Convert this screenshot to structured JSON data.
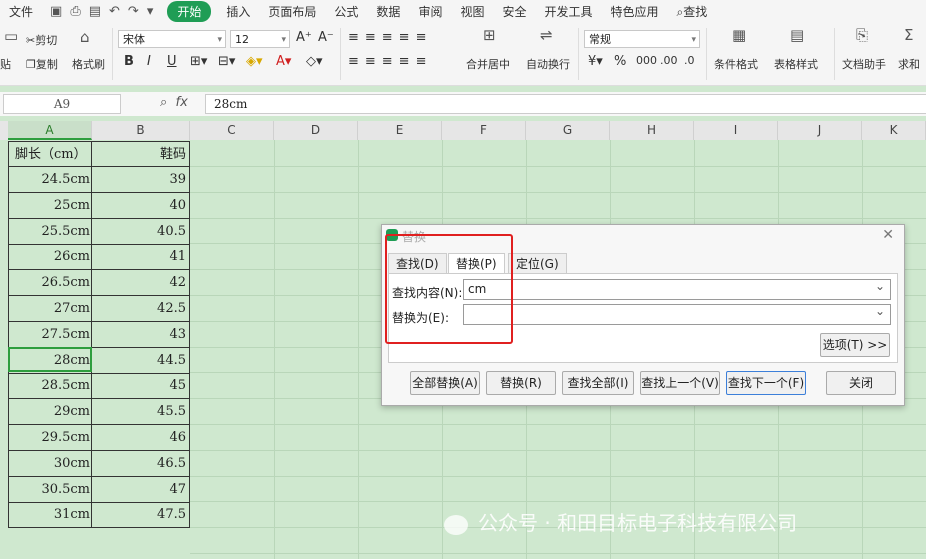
{
  "menubar": {
    "file": "文件",
    "tabs": [
      "开始",
      "插入",
      "页面布局",
      "公式",
      "数据",
      "审阅",
      "视图",
      "安全",
      "开发工具",
      "特色应用"
    ],
    "search": "查找"
  },
  "ribbon": {
    "paste": "贴",
    "cut": "剪切",
    "copy": "复制",
    "format_painter": "格式刷",
    "font_name": "宋体",
    "font_size": "12",
    "bold": "B",
    "italic": "I",
    "underline": "U",
    "merge_center": "合并居中",
    "wrap_text": "自动换行",
    "number_format": "常规",
    "conditional_format": "条件格式",
    "table_style": "表格样式",
    "doc_assistant": "文档助手",
    "sum": "求和"
  },
  "formula_bar": {
    "name_box": "A9",
    "fx": "fx",
    "content": "28cm"
  },
  "columns": [
    "A",
    "B",
    "C",
    "D",
    "E",
    "F",
    "G",
    "H",
    "I",
    "J",
    "K"
  ],
  "table": {
    "headers": [
      "脚长（cm）",
      "鞋码"
    ],
    "rows": [
      [
        "24.5cm",
        "39"
      ],
      [
        "25cm",
        "40"
      ],
      [
        "25.5cm",
        "40.5"
      ],
      [
        "26cm",
        "41"
      ],
      [
        "26.5cm",
        "42"
      ],
      [
        "27cm",
        "42.5"
      ],
      [
        "27.5cm",
        "43"
      ],
      [
        "28cm",
        "44.5"
      ],
      [
        "28.5cm",
        "45"
      ],
      [
        "29cm",
        "45.5"
      ],
      [
        "29.5cm",
        "46"
      ],
      [
        "30cm",
        "46.5"
      ],
      [
        "30.5cm",
        "47"
      ],
      [
        "31cm",
        "47.5"
      ]
    ]
  },
  "dialog": {
    "title": "替换",
    "tabs": [
      "查找(D)",
      "替换(P)",
      "定位(G)"
    ],
    "find_label": "查找内容(N):",
    "find_value": "cm",
    "replace_label": "替换为(E):",
    "replace_value": "",
    "options_button": "选项(T) >>",
    "buttons": [
      "全部替换(A)",
      "替换(R)",
      "查找全部(I)",
      "查找上一个(V)",
      "查找下一个(F)",
      "关闭"
    ]
  },
  "watermark": "公众号 · 和田目标电子科技有限公司",
  "colors": {
    "accent": "#1f9d55",
    "sheet_bg": "#cfe8cf",
    "highlight": "#e02020"
  }
}
